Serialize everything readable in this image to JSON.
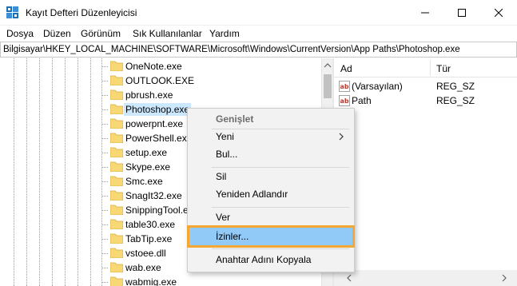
{
  "window": {
    "title": "Kayıt Defteri Düzenleyicisi"
  },
  "menu": [
    "Dosya",
    "Düzen",
    "Görünüm",
    "Sık Kullanılanlar",
    "Yardım"
  ],
  "address": "Bilgisayar\\HKEY_LOCAL_MACHINE\\SOFTWARE\\Microsoft\\Windows\\CurrentVersion\\App Paths\\Photoshop.exe",
  "tree": {
    "items": [
      "OneNote.exe",
      "OUTLOOK.EXE",
      "pbrush.exe",
      "Photoshop.exe",
      "powerpnt.exe",
      "PowerShell.exe",
      "setup.exe",
      "Skype.exe",
      "Smc.exe",
      "SnagIt32.exe",
      "SnippingTool.exe",
      "table30.exe",
      "TabTip.exe",
      "vstoee.dll",
      "wab.exe",
      "wabmig.exe"
    ],
    "selected_index": 3
  },
  "list": {
    "columns": [
      "Ad",
      "Tür"
    ],
    "rows": [
      {
        "name": "(Varsayılan)",
        "type": "REG_SZ"
      },
      {
        "name": "Path",
        "type": "REG_SZ"
      }
    ]
  },
  "context_menu": {
    "items": [
      {
        "label": "Genişlet"
      },
      {
        "label": "Yeni"
      },
      {
        "label": "Bul..."
      },
      {
        "label": "Sil"
      },
      {
        "label": "Yeniden Adlandır"
      },
      {
        "label": "Ver"
      },
      {
        "label": "İzinler..."
      },
      {
        "label": "Anahtar Adını Kopyala"
      }
    ],
    "highlighted_index": 6
  },
  "colors": {
    "folder": "#f8d775",
    "selection": "#cce8ff",
    "highlight": "#91c9f7",
    "highlight_border": "#f4a733"
  }
}
